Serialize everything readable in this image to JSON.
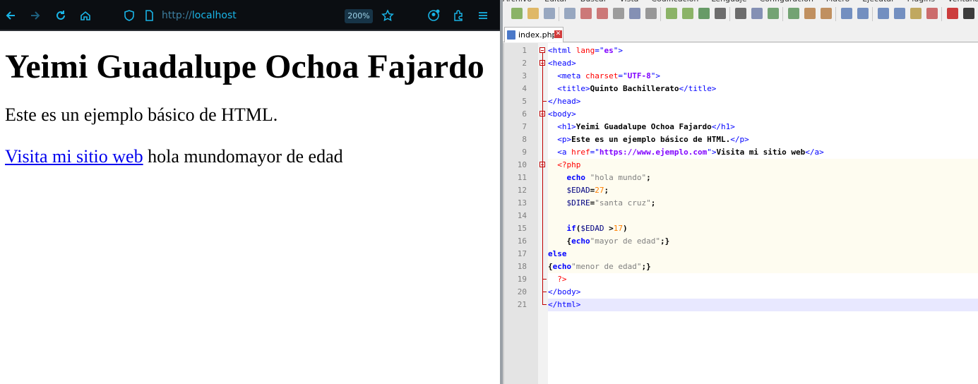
{
  "browser": {
    "url_prefix": "http://",
    "url_host": "localhost",
    "zoom": "200%",
    "page": {
      "heading": "Yeimi Guadalupe Ochoa Fajardo",
      "paragraph": "Este es un ejemplo básico de HTML.",
      "link_text": "Visita mi sitio web",
      "trailing_text": " hola mundomayor de edad"
    }
  },
  "editor": {
    "menu": [
      "Archivo",
      "Editar",
      "Buscar",
      "Vista",
      "Codificación",
      "Lenguaje",
      "Configuración",
      "Macro",
      "Ejecutar",
      "Plugins",
      "Ventana",
      "?"
    ],
    "tab": {
      "filename": "index.php",
      "close": "✕"
    },
    "lines": [
      {
        "n": "1",
        "parts": [
          [
            "t",
            "<html "
          ],
          [
            "a",
            "lang"
          ],
          [
            "t",
            "=\""
          ],
          [
            "s",
            "es"
          ],
          [
            "t",
            "\">"
          ]
        ]
      },
      {
        "n": "2",
        "parts": [
          [
            "t",
            "<head>"
          ]
        ]
      },
      {
        "n": "3",
        "parts": [
          [
            "t",
            "  <meta "
          ],
          [
            "a",
            "charset"
          ],
          [
            "t",
            "=\""
          ],
          [
            "s",
            "UTF-8"
          ],
          [
            "t",
            "\">"
          ]
        ]
      },
      {
        "n": "4",
        "parts": [
          [
            "t",
            "  <title>"
          ],
          [
            "tx",
            "Quinto Bachillerato"
          ],
          [
            "t",
            "</title>"
          ]
        ]
      },
      {
        "n": "5",
        "parts": [
          [
            "t",
            "</head>"
          ]
        ]
      },
      {
        "n": "6",
        "parts": [
          [
            "t",
            "<body>"
          ]
        ]
      },
      {
        "n": "7",
        "parts": [
          [
            "t",
            "  <h1>"
          ],
          [
            "tx",
            "Yeimi Guadalupe Ochoa Fajardo"
          ],
          [
            "t",
            "</h1>"
          ]
        ]
      },
      {
        "n": "8",
        "parts": [
          [
            "t",
            "  <p>"
          ],
          [
            "tx",
            "Este es un ejemplo básico de HTML."
          ],
          [
            "t",
            "</p>"
          ]
        ]
      },
      {
        "n": "9",
        "parts": [
          [
            "t",
            "  <a "
          ],
          [
            "a",
            "href"
          ],
          [
            "t",
            "=\""
          ],
          [
            "s",
            "https://www.ejemplo.com"
          ],
          [
            "t",
            "\">"
          ],
          [
            "tx",
            "Visita mi sitio web"
          ],
          [
            "t",
            "</a>"
          ]
        ]
      },
      {
        "n": "10",
        "parts": [
          [
            "pd",
            "  <?php"
          ]
        ]
      },
      {
        "n": "11",
        "parts": [
          [
            "k",
            "    echo "
          ],
          [
            "ps",
            "\"hola mundo\""
          ],
          [
            "tx",
            ";"
          ]
        ]
      },
      {
        "n": "12",
        "parts": [
          [
            "v",
            "    $EDAD"
          ],
          [
            "tx",
            "="
          ],
          [
            "pn",
            "27"
          ],
          [
            "tx",
            ";"
          ]
        ]
      },
      {
        "n": "13",
        "parts": [
          [
            "v",
            "    $DIRE"
          ],
          [
            "tx",
            "="
          ],
          [
            "ps",
            "\"santa cruz\""
          ],
          [
            "tx",
            ";"
          ]
        ]
      },
      {
        "n": "14",
        "parts": []
      },
      {
        "n": "15",
        "parts": [
          [
            "k",
            "    if"
          ],
          [
            "tx",
            "("
          ],
          [
            "v",
            "$EDAD "
          ],
          [
            "tx",
            ">"
          ],
          [
            "pn",
            "17"
          ],
          [
            "tx",
            ")"
          ]
        ]
      },
      {
        "n": "16",
        "parts": [
          [
            "tx",
            "    {"
          ],
          [
            "k",
            "echo"
          ],
          [
            "ps",
            "\"mayor de edad\""
          ],
          [
            "tx",
            ";}"
          ]
        ]
      },
      {
        "n": "17",
        "parts": [
          [
            "k",
            "else"
          ]
        ]
      },
      {
        "n": "18",
        "parts": [
          [
            "tx",
            "{"
          ],
          [
            "k",
            "echo"
          ],
          [
            "ps",
            "\"menor de edad\""
          ],
          [
            "tx",
            ";}"
          ]
        ]
      },
      {
        "n": "19",
        "parts": [
          [
            "pd",
            "  ?>"
          ]
        ]
      },
      {
        "n": "20",
        "parts": [
          [
            "t",
            "</body>"
          ]
        ]
      },
      {
        "n": "21",
        "parts": [
          [
            "t",
            "</html>"
          ]
        ]
      }
    ]
  }
}
